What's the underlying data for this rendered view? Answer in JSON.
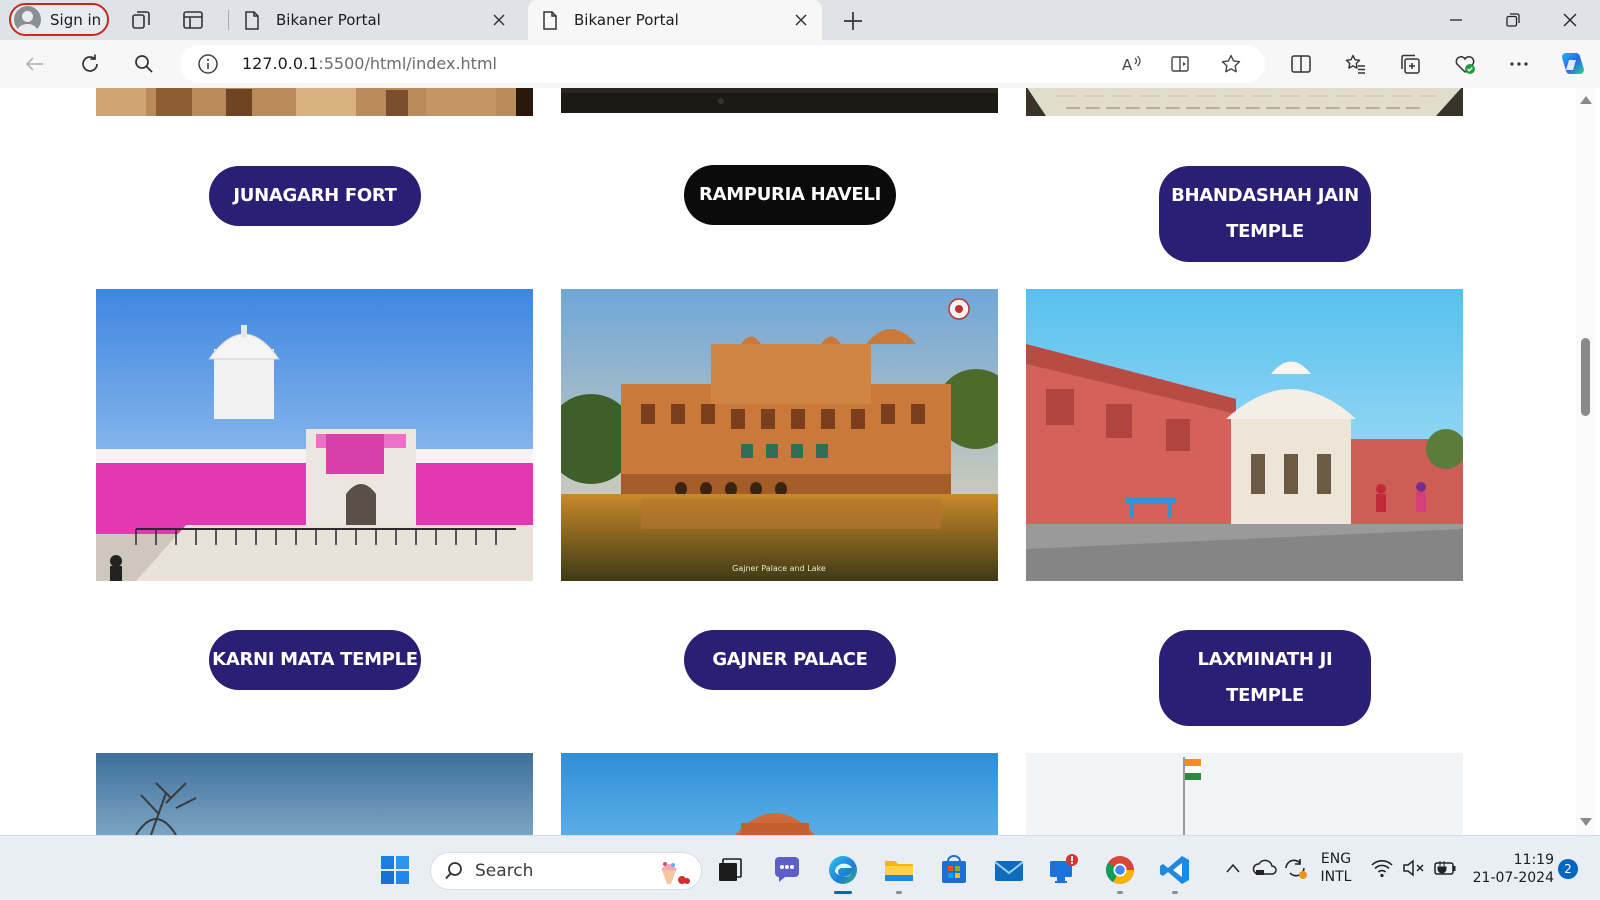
{
  "browser": {
    "profile_label": "Sign in",
    "tabs": [
      {
        "title": "Bikaner Portal",
        "active": false
      },
      {
        "title": "Bikaner Portal",
        "active": true
      }
    ],
    "url_host": "127.0.0.1",
    "url_rest": ":5500/html/index.html"
  },
  "page": {
    "row1_labels": [
      "JUNAGARH FORT",
      "RAMPURIA HAVELI",
      "BHANDASHAH JAIN TEMPLE"
    ],
    "row2_labels": [
      "KARNI MATA TEMPLE",
      "GAJNER PALACE",
      "LAXMINATH JI TEMPLE"
    ],
    "photo_caption": "Gajner Palace and Lake",
    "colors": {
      "pill_primary": "#2a1f74",
      "pill_hover": "#0b0b0b"
    }
  },
  "taskbar": {
    "search_placeholder": "Search",
    "language_line1": "ENG",
    "language_line2": "INTL",
    "time": "11:19",
    "date": "21-07-2024",
    "notification_count": "2"
  }
}
